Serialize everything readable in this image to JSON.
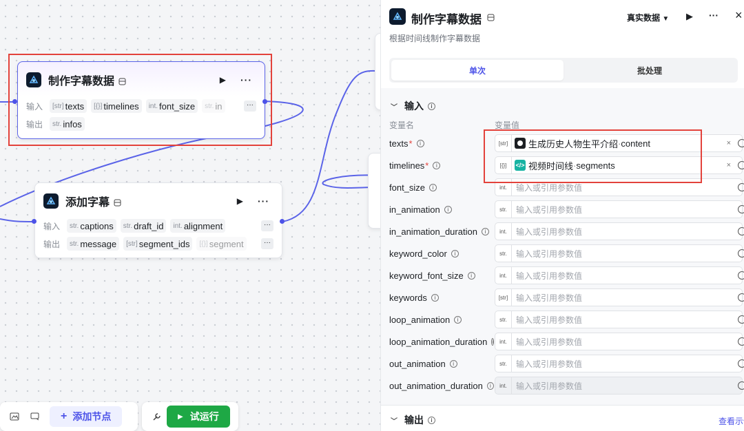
{
  "canvas": {
    "node_main": {
      "title": "制作字幕数据",
      "input_label": "输入",
      "output_label": "输出",
      "inputs": [
        {
          "type": "[str]",
          "name": "texts"
        },
        {
          "type": "[{}]",
          "name": "timelines"
        },
        {
          "type": "int.",
          "name": "font_size"
        },
        {
          "type": "str.",
          "name": "in"
        }
      ],
      "outputs": [
        {
          "type": "str.",
          "name": "infos"
        }
      ],
      "more_label": "···"
    },
    "node_add": {
      "title": "添加字幕",
      "input_label": "输入",
      "output_label": "输出",
      "inputs": [
        {
          "type": "str.",
          "name": "captions"
        },
        {
          "type": "str.",
          "name": "draft_id"
        },
        {
          "type": "int.",
          "name": "alignment"
        }
      ],
      "outputs": [
        {
          "type": "str.",
          "name": "message"
        },
        {
          "type": "[str]",
          "name": "segment_ids"
        },
        {
          "type": "[{}]",
          "name": "segment"
        }
      ],
      "more_label": "···"
    },
    "toolbar": {
      "add_node": "添加节点",
      "run": "试运行"
    }
  },
  "panel": {
    "title": "制作字幕数据",
    "mode_select": "真实数据",
    "description": "根据时间线制作字幕数据",
    "tabs": [
      "单次",
      "批处理"
    ],
    "input_section": "输入",
    "col_name": "变量名",
    "col_value": "变量值",
    "placeholder": "输入或引用参数值",
    "params": [
      {
        "name": "texts",
        "required": true,
        "type": "[str]",
        "ref": {
          "source": "生成历史人物生平介绍",
          "field": "content",
          "color": "#1c1f23"
        }
      },
      {
        "name": "timelines",
        "required": true,
        "type": "[{}]",
        "ref": {
          "source": "视频时间线",
          "field": "segments",
          "color": "#17b3a3"
        }
      },
      {
        "name": "font_size",
        "type": "int."
      },
      {
        "name": "in_animation",
        "type": "str."
      },
      {
        "name": "in_animation_duration",
        "type": "int."
      },
      {
        "name": "keyword_color",
        "type": "str."
      },
      {
        "name": "keyword_font_size",
        "type": "int."
      },
      {
        "name": "keywords",
        "type": "[str]"
      },
      {
        "name": "loop_animation",
        "type": "str."
      },
      {
        "name": "loop_animation_duration",
        "type": "int."
      },
      {
        "name": "out_animation",
        "type": "str."
      },
      {
        "name": "out_animation_duration",
        "type": "int."
      }
    ],
    "output_section": "输出",
    "view_example": "查看示例"
  },
  "colors": {
    "accent": "#4d53e8",
    "highlight": "#e3423b",
    "run": "#1ea845"
  }
}
